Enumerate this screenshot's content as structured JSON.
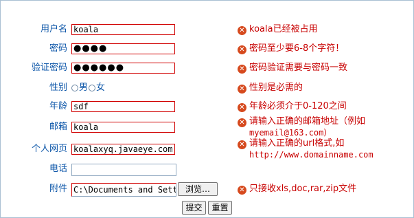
{
  "form": {
    "username": {
      "label": "用户名",
      "value": "koala",
      "error": "koala已经被占用"
    },
    "password": {
      "label": "密码",
      "value": "●●●●",
      "error": "密码至少要6-8个字符！"
    },
    "confirm": {
      "label": "验证密码",
      "value": "●●●●●●",
      "error": "密码验证需要与密码一致"
    },
    "gender": {
      "label": "性别",
      "options": [
        "男",
        "女"
      ],
      "error": "性别是必需的"
    },
    "age": {
      "label": "年龄",
      "value": "sdf",
      "error": "年龄必须介于0-120之间"
    },
    "email": {
      "label": "邮箱",
      "value": "koala",
      "error_line1": "请输入正确的邮箱地址（例如",
      "error_line2": "myemail@163.com）"
    },
    "homepage": {
      "label": "个人网页",
      "value": "koalaxyq.javaeye.com",
      "error_line1": "请输入正确的url格式,如",
      "error_line2": "http://www.domainname.com"
    },
    "phone": {
      "label": "电话",
      "value": ""
    },
    "attachment": {
      "label": "附件",
      "value": "C:\\Documents and Sett",
      "browse_label": "浏览…",
      "error": "只接收xls,doc,rar,zip文件"
    },
    "submit_label": "提交",
    "reset_label": "重置"
  },
  "error_icon": "error-x-icon",
  "colors": {
    "label": "#0b55a8",
    "error": "#c80000",
    "error_border": "#d10000",
    "icon": "#d64a1e"
  }
}
